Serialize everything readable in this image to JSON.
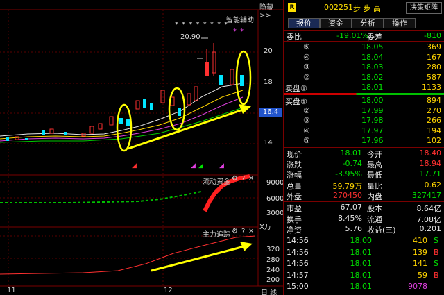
{
  "header": {
    "hide_label": "隐藏",
    "expand_icon": "double-chevron-right",
    "r_badge": "R",
    "stock_code": "002251",
    "stock_name": "步 步 高",
    "decision_button": "决策矩阵"
  },
  "chart": {
    "helper_label": "智能辅助",
    "stars_row1": "* * *   * * *   * *",
    "stars_row2": "* *",
    "price_annotation": "20.90",
    "price_axis": [
      "20",
      "18",
      "16.4",
      "14"
    ],
    "current_price": "16.4",
    "month_labels": [
      "11",
      "12"
    ],
    "bottom_right": "日 线"
  },
  "panels": {
    "capital": {
      "title": "流动资金",
      "axis": [
        "9000",
        "6000",
        "3000"
      ],
      "unit": "X万"
    },
    "tracking": {
      "title": "主力追踪",
      "axis": [
        "320",
        "280",
        "240",
        "200"
      ]
    }
  },
  "right": {
    "tabs": [
      "报价",
      "资金",
      "分析",
      "操作"
    ],
    "weibi": {
      "label": "委比",
      "value": "-19.01%",
      "label2": "委差",
      "value2": "-810"
    },
    "sell": [
      {
        "label": "⑤",
        "price": "18.05",
        "vol": "369"
      },
      {
        "label": "④",
        "price": "18.04",
        "vol": "167"
      },
      {
        "label": "③",
        "price": "18.03",
        "vol": "280"
      },
      {
        "label": "②",
        "price": "18.02",
        "vol": "587"
      },
      {
        "label": "卖盘①",
        "price": "18.01",
        "vol": "1133"
      }
    ],
    "buy": [
      {
        "label": "买盘①",
        "price": "18.00",
        "vol": "894"
      },
      {
        "label": "②",
        "price": "17.99",
        "vol": "270"
      },
      {
        "label": "③",
        "price": "17.98",
        "vol": "266"
      },
      {
        "label": "④",
        "price": "17.97",
        "vol": "194"
      },
      {
        "label": "⑤",
        "price": "17.96",
        "vol": "102"
      }
    ],
    "quote": [
      {
        "l1": "现价",
        "v1": "18.01",
        "l2": "今开",
        "v2": "18.40"
      },
      {
        "l1": "涨跌",
        "v1": "-0.74",
        "l2": "最高",
        "v2": "18.94"
      },
      {
        "l1": "涨幅",
        "v1": "-3.95%",
        "l2": "最低",
        "v2": "17.71"
      },
      {
        "l1": "总量",
        "v1": "59.79万",
        "l2": "量比",
        "v2": "0.62"
      },
      {
        "l1": "外盘",
        "v1": "270450",
        "l2": "内盘",
        "v2": "327417"
      }
    ],
    "finance": [
      {
        "l1": "市盈",
        "v1": "67.07",
        "l2": "股本",
        "v2": "8.64亿"
      },
      {
        "l1": "换手",
        "v1": "8.45%",
        "l2": "流通",
        "v2": "7.08亿"
      },
      {
        "l1": "净资",
        "v1": "5.76",
        "l2": "收益(三)",
        "v2": "0.201"
      }
    ],
    "ticks": [
      {
        "time": "14:56",
        "price": "18.00",
        "vol": "410",
        "side": "S"
      },
      {
        "time": "14:56",
        "price": "18.01",
        "vol": "139",
        "side": "B"
      },
      {
        "time": "14:56",
        "price": "18.01",
        "vol": "141",
        "side": "S"
      },
      {
        "time": "14:57",
        "price": "18.01",
        "vol": "59",
        "side": "B"
      },
      {
        "time": "15:00",
        "price": "18.01",
        "vol": "9078",
        "side": ""
      }
    ]
  }
}
